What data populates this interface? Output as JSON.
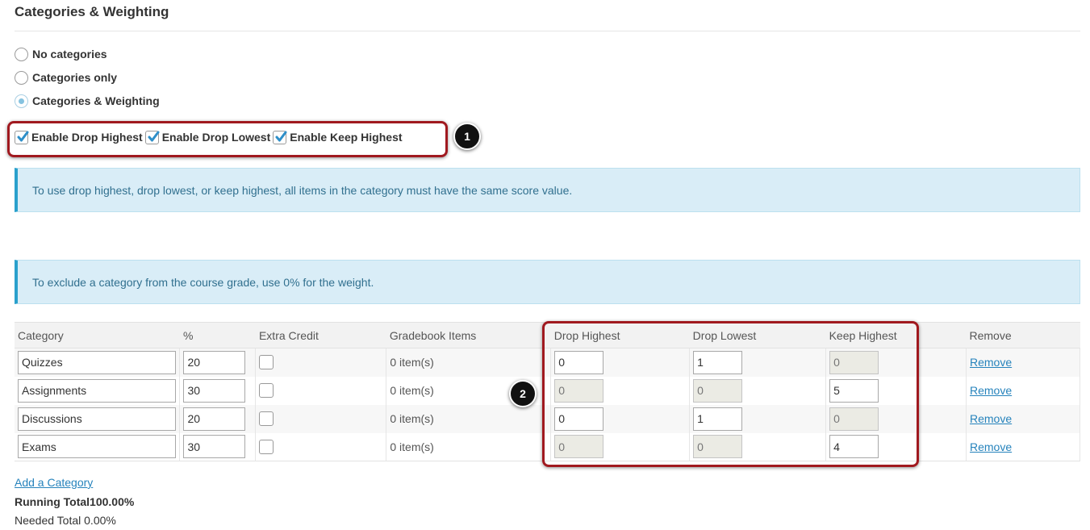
{
  "section_title": "Categories & Weighting",
  "radios": [
    {
      "label": "No categories",
      "selected": false
    },
    {
      "label": "Categories only",
      "selected": false
    },
    {
      "label": "Categories & Weighting",
      "selected": true
    }
  ],
  "options": {
    "drop_highest": "Enable Drop Highest",
    "drop_lowest": "Enable Drop Lowest",
    "keep_highest": "Enable Keep Highest"
  },
  "badges": {
    "one": "1",
    "two": "2"
  },
  "info": {
    "drop_note": "To use drop highest, drop lowest, or keep highest, all items in the category must have the same score value.",
    "exclude_note": "To exclude a category from the course grade, use 0% for the weight."
  },
  "table": {
    "headers": {
      "category": "Category",
      "percent": "%",
      "extra_credit": "Extra Credit",
      "gradebook_items": "Gradebook Items",
      "drop_highest": "Drop Highest",
      "drop_lowest": "Drop Lowest",
      "keep_highest": "Keep Highest",
      "remove": "Remove"
    },
    "rows": [
      {
        "category": "Quizzes",
        "percent": "20",
        "items": "0 item(s)",
        "drop_highest": "0",
        "drop_lowest": "1",
        "keep_highest": "0",
        "remove": "Remove"
      },
      {
        "category": "Assignments",
        "percent": "30",
        "items": "0 item(s)",
        "drop_highest": "0",
        "drop_lowest": "0",
        "keep_highest": "5",
        "remove": "Remove"
      },
      {
        "category": "Discussions",
        "percent": "20",
        "items": "0 item(s)",
        "drop_highest": "0",
        "drop_lowest": "1",
        "keep_highest": "0",
        "remove": "Remove"
      },
      {
        "category": "Exams",
        "percent": "30",
        "items": "0 item(s)",
        "drop_highest": "0",
        "drop_lowest": "0",
        "keep_highest": "4",
        "remove": "Remove"
      }
    ]
  },
  "add_category": "Add a Category",
  "running_total": "Running Total100.00%",
  "needed_total": "Needed Total 0.00%",
  "colors": {
    "annotation": "#a0191f",
    "info_bg": "#d9edf7",
    "link": "#2683bc"
  }
}
